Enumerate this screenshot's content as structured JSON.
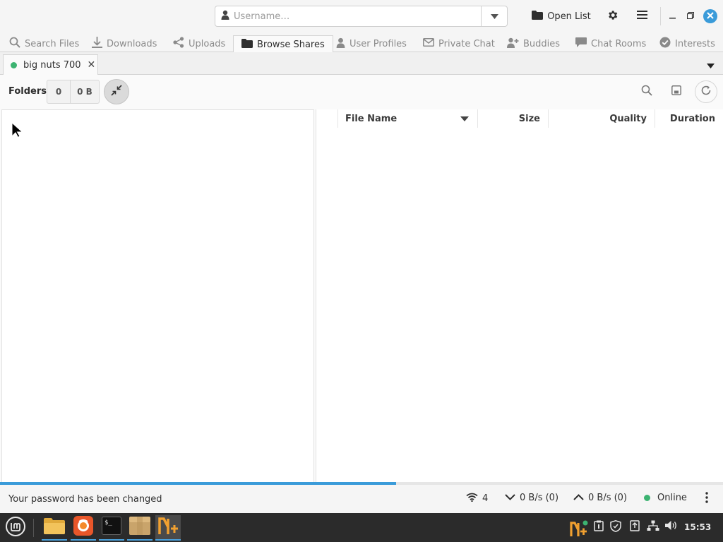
{
  "header": {
    "username_placeholder": "Username…",
    "open_list_label": "Open List"
  },
  "main_tabs": [
    {
      "label": "Search Files",
      "icon": "search-icon"
    },
    {
      "label": "Downloads",
      "icon": "download-icon"
    },
    {
      "label": "Uploads",
      "icon": "share-icon"
    },
    {
      "label": "Browse Shares",
      "icon": "folder-icon",
      "active": true
    },
    {
      "label": "User Profiles",
      "icon": "person-icon"
    },
    {
      "label": "Private Chat",
      "icon": "mail-icon"
    },
    {
      "label": "Buddies",
      "icon": "add-person-icon"
    },
    {
      "label": "Chat Rooms",
      "icon": "chat-icon"
    },
    {
      "label": "Interests",
      "icon": "check-circle-icon"
    }
  ],
  "sub_tab": {
    "label": "big nuts 700",
    "close": "✕",
    "status_color": "#3cb371"
  },
  "toolbar": {
    "folders_label": "Folders",
    "folder_count": "0",
    "folder_size": "0 B"
  },
  "file_columns": {
    "file_name": "File Name",
    "size": "Size",
    "quality": "Quality",
    "duration": "Duration"
  },
  "progress": {
    "fraction": 0.548
  },
  "statusbar": {
    "message": "Your password has been changed",
    "connections": "4",
    "download_speed": "0 B/s (0)",
    "upload_speed": "0 B/s (0)",
    "status": "Online"
  },
  "taskbar": {
    "clock": "15:53"
  },
  "colors": {
    "accent": "#3a9bd9",
    "online": "#3cb371",
    "nicotine_orange": "#f0a030"
  }
}
